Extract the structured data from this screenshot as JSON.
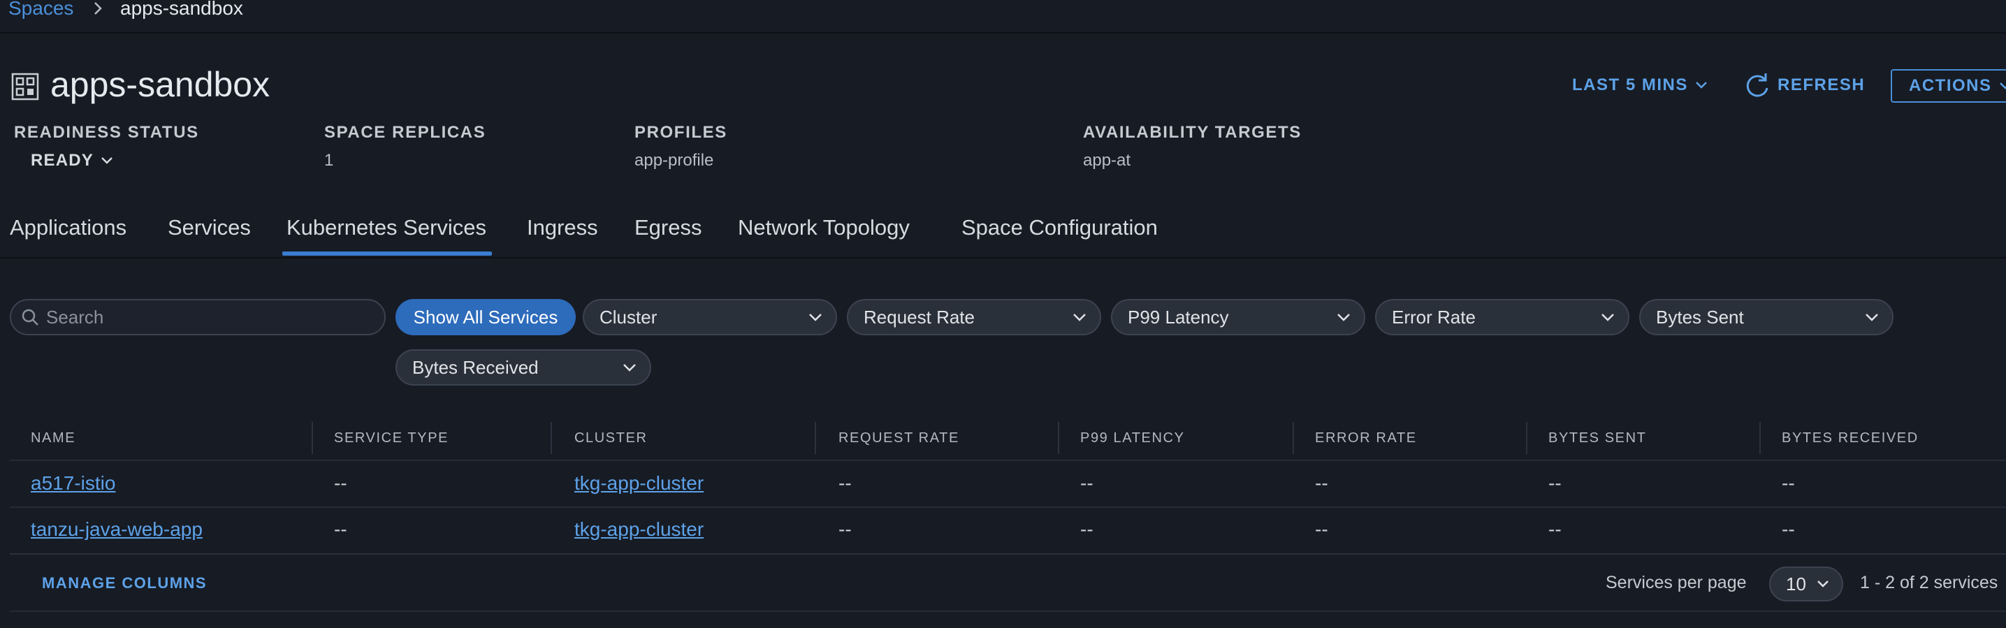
{
  "breadcrumb": {
    "parent": "Spaces",
    "current": "apps-sandbox"
  },
  "header": {
    "title": "apps-sandbox",
    "time_range": "LAST 5 MINS",
    "refresh": "REFRESH",
    "actions": "ACTIONS"
  },
  "status": {
    "readiness_label": "READINESS STATUS",
    "readiness_value": "READY",
    "replicas_label": "SPACE REPLICAS",
    "replicas_value": "1",
    "profiles_label": "PROFILES",
    "profiles_value": "app-profile",
    "targets_label": "AVAILABILITY TARGETS",
    "targets_value": "app-at"
  },
  "tabs": [
    {
      "label": "Applications"
    },
    {
      "label": "Services"
    },
    {
      "label": "Kubernetes Services",
      "active": true
    },
    {
      "label": "Ingress"
    },
    {
      "label": "Egress"
    },
    {
      "label": "Network Topology"
    },
    {
      "label": "Space Configuration"
    }
  ],
  "filters": {
    "search_placeholder": "Search",
    "show_all": "Show All Services",
    "selects": [
      "Cluster",
      "Request Rate",
      "P99 Latency",
      "Error Rate",
      "Bytes Sent",
      "Bytes Received"
    ]
  },
  "table": {
    "columns": [
      "NAME",
      "SERVICE TYPE",
      "CLUSTER",
      "REQUEST RATE",
      "P99 LATENCY",
      "ERROR RATE",
      "BYTES SENT",
      "BYTES RECEIVED"
    ],
    "rows": [
      {
        "name": "a517-istio",
        "service_type": "--",
        "cluster": "tkg-app-cluster",
        "request_rate": "--",
        "p99_latency": "--",
        "error_rate": "--",
        "bytes_sent": "--",
        "bytes_received": "--"
      },
      {
        "name": "tanzu-java-web-app",
        "service_type": "--",
        "cluster": "tkg-app-cluster",
        "request_rate": "--",
        "p99_latency": "--",
        "error_rate": "--",
        "bytes_sent": "--",
        "bytes_received": "--"
      }
    ]
  },
  "footer": {
    "manage_columns": "MANAGE COLUMNS",
    "per_page_label": "Services per page",
    "per_page_value": "10",
    "pagination": "1 - 2 of 2 services"
  },
  "colors": {
    "background": "#171b24",
    "accent": "#5da2e8",
    "primary_button": "#2d6bbb",
    "tab_underline": "#3b7dd0"
  },
  "icons": {
    "title": "grid-icon",
    "breadcrumb_sep": "chevron-right-icon",
    "refresh": "refresh-icon",
    "search": "search-icon",
    "dropdown": "chevron-down-icon"
  }
}
